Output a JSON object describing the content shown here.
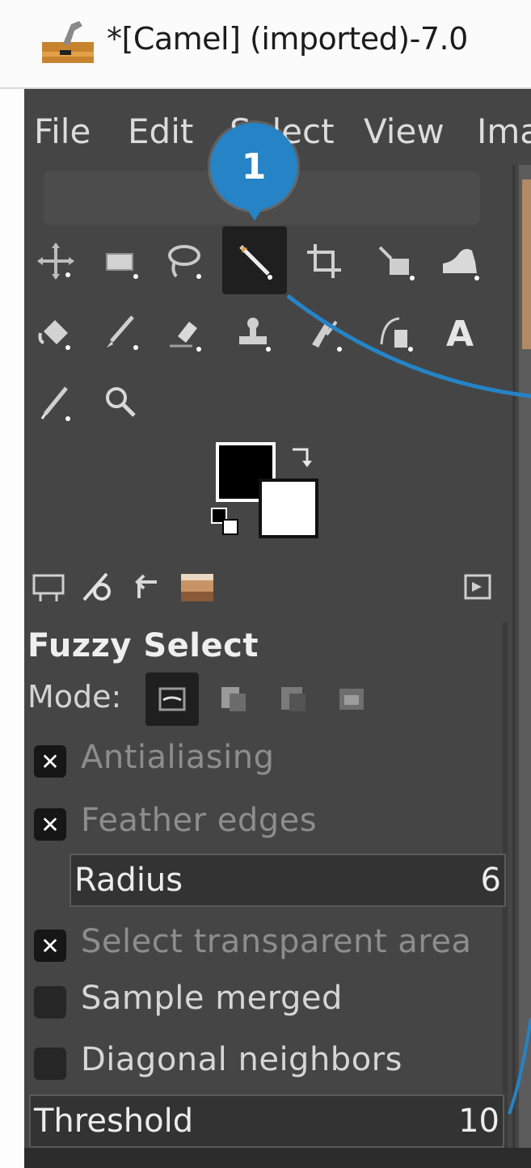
{
  "window": {
    "title": "*[Camel] (imported)-7.0",
    "app_icon": "gimp-icon"
  },
  "menu": {
    "items": [
      "File",
      "Edit",
      "Select",
      "View",
      "Ima"
    ]
  },
  "annotation": {
    "badge_text": "1",
    "color": "#2583c6"
  },
  "toolbox": {
    "active_tool": "fuzzy-select-tool",
    "tools": [
      "move-tool",
      "rect-select-tool",
      "free-select-tool",
      "fuzzy-select-tool",
      "crop-tool",
      "unified-transform-tool",
      "warp-transform-tool",
      "bucket-fill-tool",
      "paintbrush-tool",
      "eraser-tool",
      "clone-tool",
      "smudge-tool",
      "paths-tool",
      "text-tool",
      "color-picker-tool",
      "zoom-tool"
    ]
  },
  "colors": {
    "foreground": "#000000",
    "background": "#ffffff"
  },
  "dock": {
    "tabs": [
      "tool-options-tab-icon",
      "device-status-tab-icon",
      "undo-history-tab-icon",
      "images-tab-icon"
    ],
    "menu_icon": "dock-menu-icon"
  },
  "tool_options": {
    "title": "Fuzzy Select",
    "mode_label": "Mode:",
    "modes": [
      "replace-mode-icon",
      "add-mode-icon",
      "subtract-mode-icon",
      "intersect-mode-icon"
    ],
    "antialiasing": {
      "label": "Antialiasing",
      "checked": true
    },
    "feather_edges": {
      "label": "Feather edges",
      "checked": true
    },
    "radius": {
      "label": "Radius",
      "value": "6"
    },
    "select_transparent": {
      "label": "Select transparent area",
      "checked": true
    },
    "sample_merged": {
      "label": "Sample merged",
      "checked": false
    },
    "diagonal_neighbors": {
      "label": "Diagonal neighbors",
      "checked": false
    },
    "threshold": {
      "label": "Threshold",
      "value": "10"
    }
  }
}
